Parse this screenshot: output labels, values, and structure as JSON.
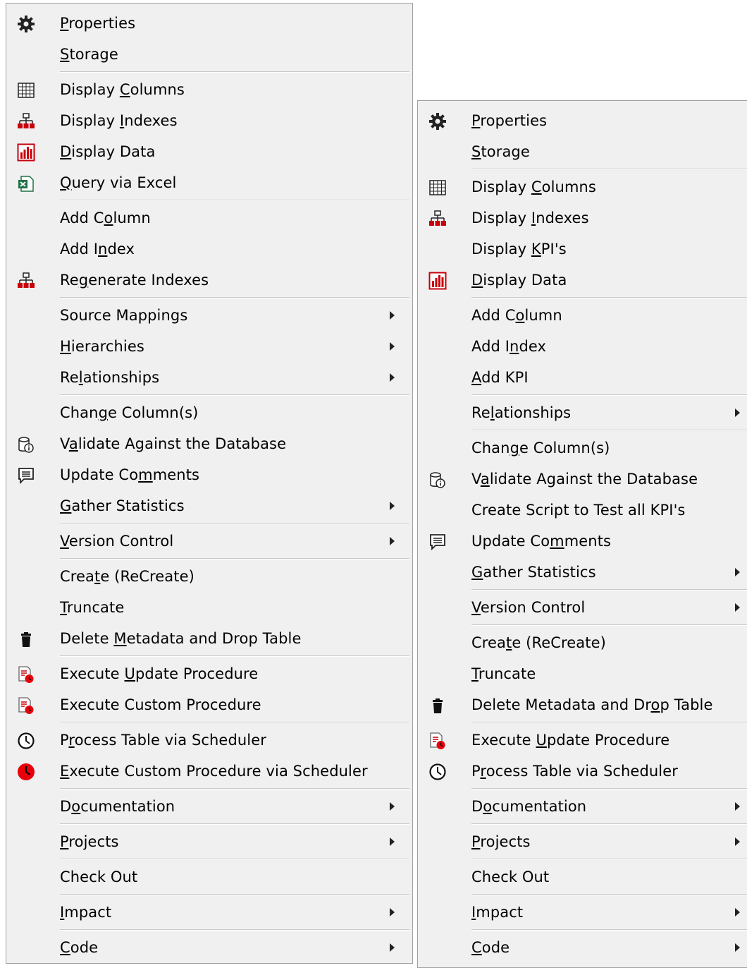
{
  "menus": [
    {
      "items": [
        {
          "type": "item",
          "icon": "gear-icon",
          "pre": "",
          "ul": "P",
          "post": "roperties",
          "submenu": false
        },
        {
          "type": "item",
          "icon": "",
          "pre": "",
          "ul": "S",
          "post": "torage",
          "submenu": false
        },
        {
          "type": "sep"
        },
        {
          "type": "item",
          "icon": "grid-icon",
          "pre": "Display ",
          "ul": "C",
          "post": "olumns",
          "submenu": false
        },
        {
          "type": "item",
          "icon": "hierarchy-icon",
          "pre": "Display ",
          "ul": "I",
          "post": "ndexes",
          "submenu": false
        },
        {
          "type": "item",
          "icon": "chart-icon",
          "pre": "",
          "ul": "D",
          "post": "isplay Data",
          "submenu": false
        },
        {
          "type": "item",
          "icon": "excel-icon",
          "pre": "",
          "ul": "Q",
          "post": "uery via Excel",
          "submenu": false
        },
        {
          "type": "sep"
        },
        {
          "type": "item",
          "icon": "",
          "pre": "Add C",
          "ul": "o",
          "post": "lumn",
          "submenu": false
        },
        {
          "type": "item",
          "icon": "",
          "pre": "Add I",
          "ul": "n",
          "post": "dex",
          "submenu": false
        },
        {
          "type": "item",
          "icon": "hierarchy-icon",
          "pre": "Re",
          "ul": "g",
          "post": "enerate Indexes",
          "submenu": false
        },
        {
          "type": "sep"
        },
        {
          "type": "item",
          "icon": "",
          "pre": "Source Mappings",
          "ul": "",
          "post": "",
          "submenu": true
        },
        {
          "type": "item",
          "icon": "",
          "pre": "",
          "ul": "H",
          "post": "ierarchies",
          "submenu": true
        },
        {
          "type": "item",
          "icon": "",
          "pre": "Re",
          "ul": "l",
          "post": "ationships",
          "submenu": true
        },
        {
          "type": "sep"
        },
        {
          "type": "item",
          "icon": "",
          "pre": "Chan",
          "ul": "g",
          "post": "e Column(s)",
          "submenu": false
        },
        {
          "type": "item",
          "icon": "db-info-icon",
          "pre": "V",
          "ul": "a",
          "post": "lidate Against the Database",
          "submenu": false
        },
        {
          "type": "item",
          "icon": "comment-icon",
          "pre": "Update Co",
          "ul": "m",
          "post": "ments",
          "submenu": false
        },
        {
          "type": "item",
          "icon": "",
          "pre": "",
          "ul": "G",
          "post": "ather Statistics",
          "submenu": true
        },
        {
          "type": "sep"
        },
        {
          "type": "item",
          "icon": "",
          "pre": "",
          "ul": "V",
          "post": "ersion Control",
          "submenu": true
        },
        {
          "type": "sep"
        },
        {
          "type": "item",
          "icon": "",
          "pre": "Crea",
          "ul": "t",
          "post": "e (ReCreate)",
          "submenu": false
        },
        {
          "type": "item",
          "icon": "",
          "pre": "",
          "ul": "T",
          "post": "runcate",
          "submenu": false
        },
        {
          "type": "item",
          "icon": "trash-icon",
          "pre": "Delete ",
          "ul": "M",
          "post": "etadata and Drop Table",
          "submenu": false
        },
        {
          "type": "sep"
        },
        {
          "type": "item",
          "icon": "procedure-icon",
          "pre": "Execute ",
          "ul": "U",
          "post": "pdate Procedure",
          "submenu": false
        },
        {
          "type": "item",
          "icon": "procedure-icon",
          "pre": "Execute Custom Procedure",
          "ul": "",
          "post": "",
          "submenu": false
        },
        {
          "type": "sep"
        },
        {
          "type": "item",
          "icon": "clock-icon",
          "pre": "P",
          "ul": "r",
          "post": "ocess Table via Scheduler",
          "submenu": false
        },
        {
          "type": "item",
          "icon": "red-clock-icon",
          "pre": "",
          "ul": "E",
          "post": "xecute Custom Procedure via Scheduler",
          "submenu": false
        },
        {
          "type": "sep"
        },
        {
          "type": "item",
          "icon": "",
          "pre": "D",
          "ul": "o",
          "post": "cumentation",
          "submenu": true
        },
        {
          "type": "sep"
        },
        {
          "type": "item",
          "icon": "",
          "pre": "",
          "ul": "P",
          "post": "rojects",
          "submenu": true
        },
        {
          "type": "sep"
        },
        {
          "type": "item",
          "icon": "",
          "pre": "Check Out",
          "ul": "",
          "post": "",
          "submenu": false
        },
        {
          "type": "sep"
        },
        {
          "type": "item",
          "icon": "",
          "pre": "",
          "ul": "I",
          "post": "mpact",
          "submenu": true
        },
        {
          "type": "sep"
        },
        {
          "type": "item",
          "icon": "",
          "pre": "",
          "ul": "C",
          "post": "ode",
          "submenu": true
        }
      ]
    },
    {
      "items": [
        {
          "type": "item",
          "icon": "gear-icon",
          "pre": "",
          "ul": "P",
          "post": "roperties",
          "submenu": false
        },
        {
          "type": "item",
          "icon": "",
          "pre": "",
          "ul": "S",
          "post": "torage",
          "submenu": false
        },
        {
          "type": "sep"
        },
        {
          "type": "item",
          "icon": "grid-icon",
          "pre": "Display ",
          "ul": "C",
          "post": "olumns",
          "submenu": false
        },
        {
          "type": "item",
          "icon": "hierarchy-icon",
          "pre": "Display ",
          "ul": "I",
          "post": "ndexes",
          "submenu": false
        },
        {
          "type": "item",
          "icon": "",
          "pre": "Display ",
          "ul": "K",
          "post": "PI's",
          "submenu": false
        },
        {
          "type": "item",
          "icon": "chart-icon",
          "pre": "",
          "ul": "D",
          "post": "isplay Data",
          "submenu": false
        },
        {
          "type": "sep"
        },
        {
          "type": "item",
          "icon": "",
          "pre": "Add C",
          "ul": "o",
          "post": "lumn",
          "submenu": false
        },
        {
          "type": "item",
          "icon": "",
          "pre": "Add I",
          "ul": "n",
          "post": "dex",
          "submenu": false
        },
        {
          "type": "item",
          "icon": "",
          "pre": "",
          "ul": "A",
          "post": "dd KPI",
          "submenu": false
        },
        {
          "type": "sep"
        },
        {
          "type": "item",
          "icon": "",
          "pre": "Re",
          "ul": "l",
          "post": "ationships",
          "submenu": true
        },
        {
          "type": "sep"
        },
        {
          "type": "item",
          "icon": "",
          "pre": "Chan",
          "ul": "g",
          "post": "e Column(s)",
          "submenu": false
        },
        {
          "type": "item",
          "icon": "db-info-icon",
          "pre": "V",
          "ul": "a",
          "post": "lidate Against the Database",
          "submenu": false
        },
        {
          "type": "item",
          "icon": "",
          "pre": "Create Script to Test all KPI's",
          "ul": "",
          "post": "",
          "submenu": false
        },
        {
          "type": "item",
          "icon": "comment-icon",
          "pre": "Update Co",
          "ul": "m",
          "post": "ments",
          "submenu": false
        },
        {
          "type": "item",
          "icon": "",
          "pre": "",
          "ul": "G",
          "post": "ather Statistics",
          "submenu": true
        },
        {
          "type": "sep"
        },
        {
          "type": "item",
          "icon": "",
          "pre": "",
          "ul": "V",
          "post": "ersion Control",
          "submenu": true
        },
        {
          "type": "sep"
        },
        {
          "type": "item",
          "icon": "",
          "pre": "Crea",
          "ul": "t",
          "post": "e (ReCreate)",
          "submenu": false
        },
        {
          "type": "item",
          "icon": "",
          "pre": "",
          "ul": "T",
          "post": "runcate",
          "submenu": false
        },
        {
          "type": "item",
          "icon": "trash-icon",
          "pre": "Delete Metadata and Dr",
          "ul": "o",
          "post": "p Table",
          "submenu": false
        },
        {
          "type": "sep"
        },
        {
          "type": "item",
          "icon": "procedure-icon",
          "pre": "Execute ",
          "ul": "U",
          "post": "pdate Procedure",
          "submenu": false
        },
        {
          "type": "item",
          "icon": "clock-icon",
          "pre": "P",
          "ul": "r",
          "post": "ocess Table via Scheduler",
          "submenu": false
        },
        {
          "type": "sep"
        },
        {
          "type": "item",
          "icon": "",
          "pre": "D",
          "ul": "o",
          "post": "cumentation",
          "submenu": true
        },
        {
          "type": "sep"
        },
        {
          "type": "item",
          "icon": "",
          "pre": "",
          "ul": "P",
          "post": "rojects",
          "submenu": true
        },
        {
          "type": "sep"
        },
        {
          "type": "item",
          "icon": "",
          "pre": "Check Out",
          "ul": "",
          "post": "",
          "submenu": false
        },
        {
          "type": "sep"
        },
        {
          "type": "item",
          "icon": "",
          "pre": "",
          "ul": "I",
          "post": "mpact",
          "submenu": true
        },
        {
          "type": "sep"
        },
        {
          "type": "item",
          "icon": "",
          "pre": "",
          "ul": "C",
          "post": "ode",
          "submenu": true
        }
      ]
    }
  ],
  "colors": {
    "menu_bg": "#f0f0f0",
    "separator": "#c8c8c8",
    "icon_red": "#e8000b",
    "icon_dark": "#222222",
    "excel_green": "#1e7145"
  }
}
